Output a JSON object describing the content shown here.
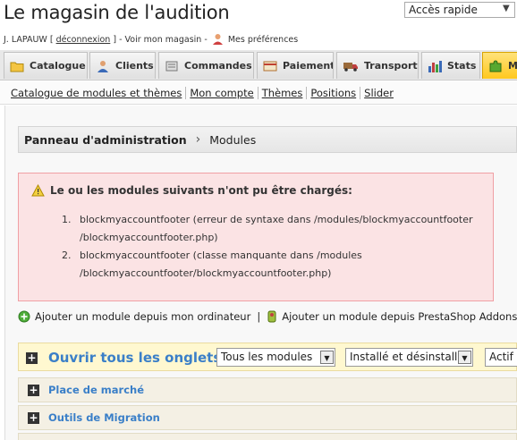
{
  "header": {
    "shop_title": "Le magasin de l'audition",
    "quick_access": "Accès rapide"
  },
  "userbar": {
    "user": "J. LAPAUW [",
    "logout": "déconnexion",
    "after_logout": "] -",
    "view_shop": "Voir mon magasin",
    "dash": "-",
    "preferences": "Mes préférences"
  },
  "tabs": [
    {
      "label": "Catalogue",
      "icon": "folder-icon"
    },
    {
      "label": "Clients",
      "icon": "user-icon"
    },
    {
      "label": "Commandes",
      "icon": "cart-icon"
    },
    {
      "label": "Paiement",
      "icon": "payment-icon"
    },
    {
      "label": "Transport",
      "icon": "truck-icon"
    },
    {
      "label": "Stats",
      "icon": "bar-chart-icon"
    },
    {
      "label": "Mo",
      "icon": "puzzle-icon",
      "active": true
    }
  ],
  "subnav": [
    "Catalogue de modules et thèmes",
    "Mon compte",
    "Thèmes",
    "Positions",
    "Slider"
  ],
  "breadcrumb": {
    "root": "Panneau d'administration",
    "current": "Modules"
  },
  "error": {
    "title": "Le ou les modules suivants n'ont pu être chargés:",
    "items": [
      {
        "num": "1.",
        "line1": "blockmyaccountfooter (erreur de syntaxe dans /modules/blockmyaccountfooter",
        "line2": "/blockmyaccountfooter.php)"
      },
      {
        "num": "2.",
        "line1": "blockmyaccountfooter (classe manquante dans /modules",
        "line2": "/blockmyaccountfooter/blockmyaccountfooter.php)"
      }
    ]
  },
  "add_links": {
    "from_computer": "Ajouter un module depuis mon ordinateur",
    "separator": "|",
    "from_addons": "Ajouter un module depuis PrestaShop Addons"
  },
  "toolbar": {
    "open_all": "Ouvrir tous les onglets",
    "filter_modules": "Tous les modules",
    "filter_install": "Installé et désinstallé",
    "filter_active": "Actif"
  },
  "categories": [
    "Place de marché",
    "Outils de Migration"
  ],
  "colors": {
    "accent_blue": "#3a7fc8",
    "error_bg": "#fbe3e4",
    "toolbar_bg": "#fff8d0",
    "active_tab": "#ffc81e"
  }
}
